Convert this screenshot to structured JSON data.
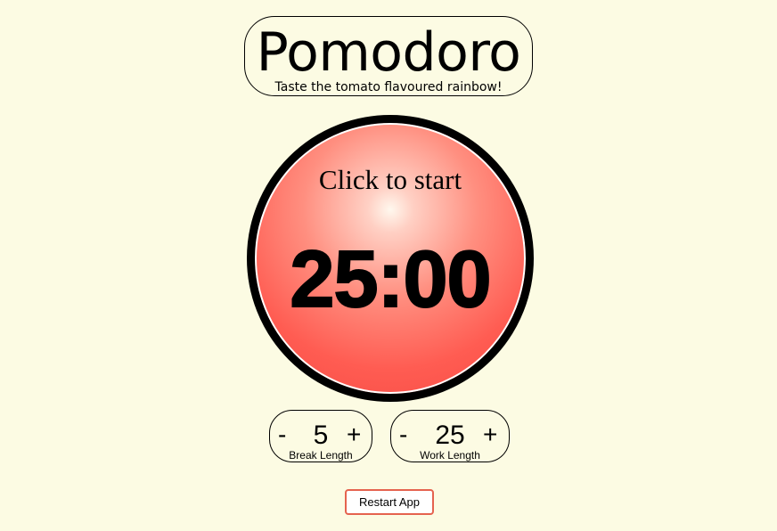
{
  "header": {
    "title": "Pomodoro",
    "subtitle": "Taste the tomato flavoured rainbow!"
  },
  "timer": {
    "status": "Click to start",
    "display": "25:00"
  },
  "break_setting": {
    "decrement_label": "-",
    "value": "5",
    "increment_label": "+",
    "label": "Break Length"
  },
  "work_setting": {
    "decrement_label": "-",
    "value": "25",
    "increment_label": "+",
    "label": "Work Length"
  },
  "restart": {
    "label": "Restart App"
  },
  "colors": {
    "background": "#fcfbe3",
    "tomato": "#ff5c52",
    "restart_border": "#e5634f"
  }
}
